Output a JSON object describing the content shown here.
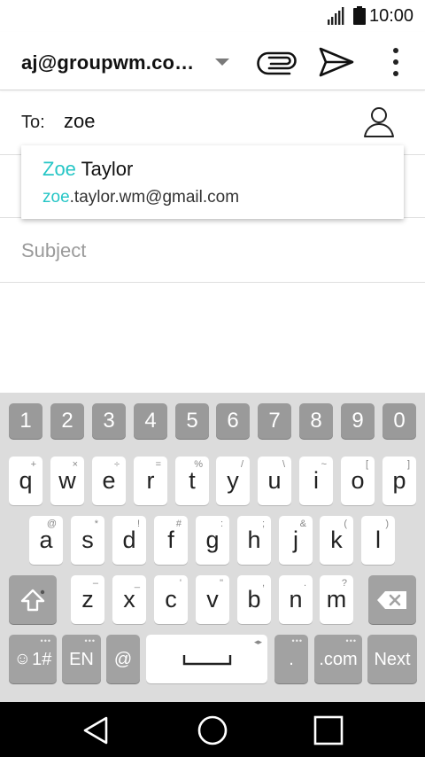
{
  "status_bar": {
    "time": "10:00"
  },
  "app_bar": {
    "from_account": "aj@groupwm.co…"
  },
  "compose": {
    "to_label": "To:",
    "to_value": "zoe",
    "subject_placeholder": "Subject"
  },
  "suggestion": {
    "name_match": "Zoe",
    "name_rest": " Taylor",
    "email_match": "zoe",
    "email_rest": ".taylor.wm@gmail.com"
  },
  "keyboard": {
    "number_row": [
      "1",
      "2",
      "3",
      "4",
      "5",
      "6",
      "7",
      "8",
      "9",
      "0"
    ],
    "row1": [
      {
        "key": "q",
        "hint": "+"
      },
      {
        "key": "w",
        "hint": "×"
      },
      {
        "key": "e",
        "hint": "÷"
      },
      {
        "key": "r",
        "hint": "="
      },
      {
        "key": "t",
        "hint": "%"
      },
      {
        "key": "y",
        "hint": "/"
      },
      {
        "key": "u",
        "hint": "\\"
      },
      {
        "key": "i",
        "hint": "~"
      },
      {
        "key": "o",
        "hint": "["
      },
      {
        "key": "p",
        "hint": "]"
      }
    ],
    "row2": [
      {
        "key": "a",
        "hint": "@"
      },
      {
        "key": "s",
        "hint": "*"
      },
      {
        "key": "d",
        "hint": "!"
      },
      {
        "key": "f",
        "hint": "#"
      },
      {
        "key": "g",
        "hint": ":"
      },
      {
        "key": "h",
        "hint": ";"
      },
      {
        "key": "j",
        "hint": "&"
      },
      {
        "key": "k",
        "hint": "("
      },
      {
        "key": "l",
        "hint": ")"
      }
    ],
    "row3": [
      {
        "key": "z",
        "hint": "–"
      },
      {
        "key": "x",
        "hint": "_"
      },
      {
        "key": "c",
        "hint": "'"
      },
      {
        "key": "v",
        "hint": "\""
      },
      {
        "key": "b",
        "hint": ","
      },
      {
        "key": "n",
        "hint": "."
      },
      {
        "key": "m",
        "hint": "?"
      }
    ],
    "symbols_label": "1#",
    "language_label": "EN",
    "at_label": "@",
    "period_label": ".",
    "dotcom_label": ".com",
    "next_label": "Next"
  },
  "colors": {
    "highlight": "#26c6c6",
    "keyboard_bg": "#dcdcdc",
    "func_key": "#a2a2a2"
  }
}
